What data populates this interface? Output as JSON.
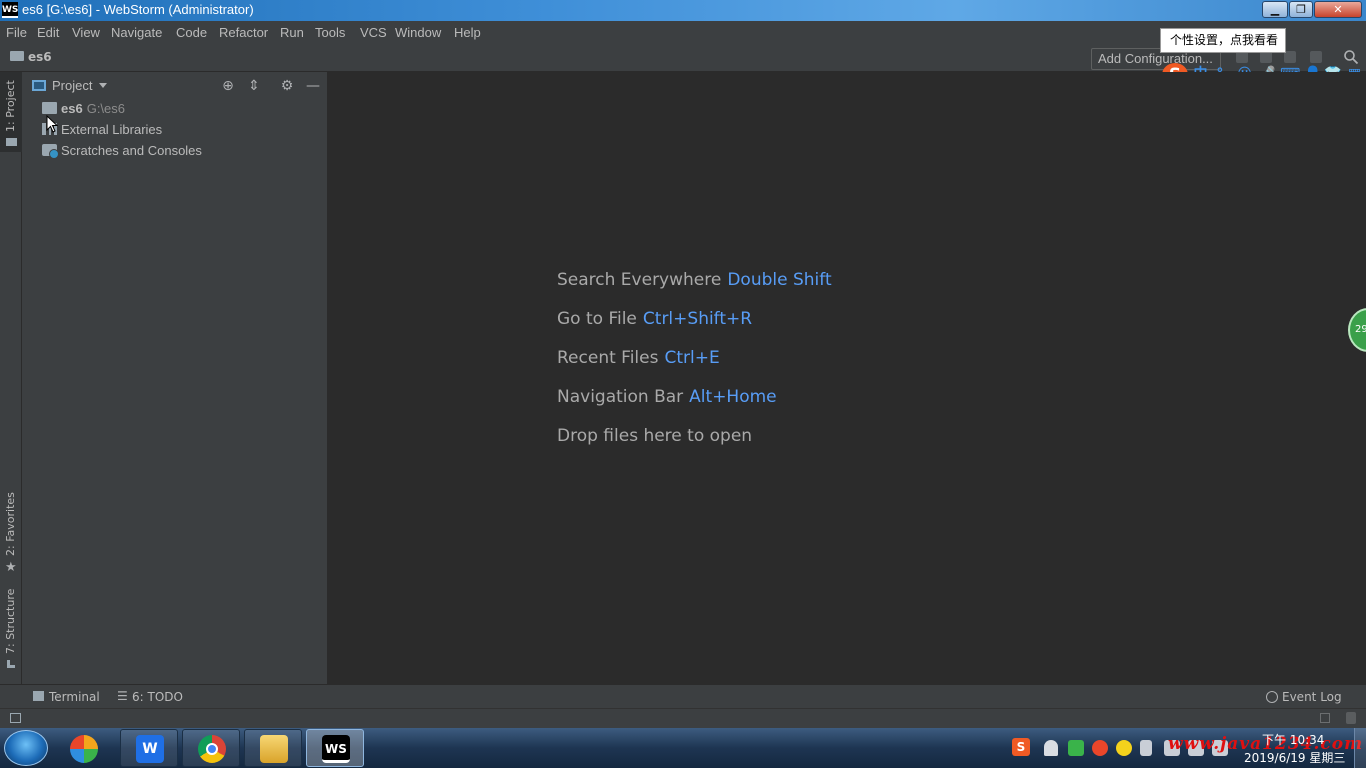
{
  "window": {
    "app_icon_text": "WS",
    "title": "es6 [G:\\es6] - WebStorm (Administrator)",
    "min_glyph": "▁",
    "max_glyph": "❐",
    "close_glyph": "✕"
  },
  "menu": [
    "File",
    "Edit",
    "View",
    "Navigate",
    "Code",
    "Refactor",
    "Run",
    "Tools",
    "VCS",
    "Window",
    "Help"
  ],
  "navbar": {
    "project_name": "es6",
    "add_configuration": "Add Configuration..."
  },
  "tooltip": "个性设置，点我看看",
  "ime": {
    "logo": "S",
    "items": [
      "中",
      "°,",
      "☺",
      "🎤",
      "⌨",
      "👤",
      "👕",
      "▦"
    ]
  },
  "left_stripe": {
    "project_tab": "1: Project",
    "favorites_tab": "2: Favorites",
    "structure_tab": "7: Structure"
  },
  "project_panel": {
    "title": "Project",
    "tree": [
      {
        "name": "es6",
        "path": "G:\\es6",
        "icon": "folder-icon"
      },
      {
        "name": "External Libraries",
        "path": "",
        "icon": "libraries-icon"
      },
      {
        "name": "Scratches and Consoles",
        "path": "",
        "icon": "scratches-icon"
      }
    ]
  },
  "editor_hints": [
    {
      "label": "Search Everywhere",
      "key": "Double Shift"
    },
    {
      "label": "Go to File",
      "key": "Ctrl+Shift+R"
    },
    {
      "label": "Recent Files",
      "key": "Ctrl+E"
    },
    {
      "label": "Navigation Bar",
      "key": "Alt+Home"
    },
    {
      "label": "Drop files here to open",
      "key": ""
    }
  ],
  "float_badge": "29",
  "bottom_tabs": {
    "terminal": "Terminal",
    "todo": "6: TODO",
    "event_log": "Event Log"
  },
  "taskbar": {
    "clock_time": "下午 10:34",
    "clock_date": "2019/6/19 星期三",
    "watermark": "www.java1234.com",
    "apps": [
      "360-icon",
      "wps-icon",
      "chrome-icon",
      "file-explorer-icon",
      "webstorm-icon"
    ]
  },
  "colors": {
    "accent_key": "#589df6",
    "panel_bg": "#3c3f41",
    "editor_bg": "#2b2b2b"
  }
}
